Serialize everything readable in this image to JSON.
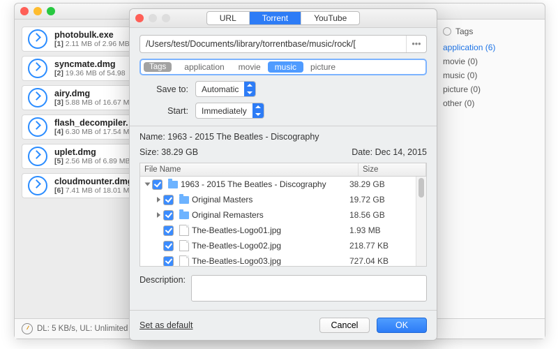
{
  "bg": {
    "downloads": [
      {
        "name": "photobulk.exe",
        "idx": "[1]",
        "done": "2.11 MB",
        "total": "2.96 MB"
      },
      {
        "name": "syncmate.dmg",
        "idx": "[2]",
        "done": "19.36 MB",
        "total": "54.98"
      },
      {
        "name": "airy.dmg",
        "idx": "[3]",
        "done": "5.88 MB",
        "total": "16.67 MB"
      },
      {
        "name": "flash_decompiler.",
        "idx": "[4]",
        "done": "6.30 MB",
        "total": "17.54 M"
      },
      {
        "name": "uplet.dmg",
        "idx": "[5]",
        "done": "2.56 MB",
        "total": "6.89 MB"
      },
      {
        "name": "cloudmounter.dmg",
        "idx": "[6]",
        "done": "7.41 MB",
        "total": "18.01 M"
      }
    ],
    "tags_head": "Tags",
    "tags": [
      {
        "label": "application",
        "count": "(6)",
        "sel": true
      },
      {
        "label": "movie",
        "count": "(0)"
      },
      {
        "label": "music",
        "count": "(0)"
      },
      {
        "label": "picture",
        "count": "(0)"
      },
      {
        "label": "other",
        "count": "(0)"
      }
    ],
    "status": "DL: 5 KB/s, UL: Unlimited"
  },
  "dlg": {
    "tabs": {
      "url": "URL",
      "torrent": "Torrent",
      "youtube": "YouTube"
    },
    "path": "/Users/test/Documents/library/torrentbase/music/rock/[",
    "tag_label": "Tags",
    "tag_chips": [
      {
        "label": "application"
      },
      {
        "label": "movie"
      },
      {
        "label": "music",
        "sel": true
      },
      {
        "label": "picture"
      }
    ],
    "saveto_lbl": "Save to:",
    "saveto_val": "Automatic",
    "start_lbl": "Start:",
    "start_val": "Immediately",
    "name_line": "Name: 1963 - 2015 The Beatles - Discography",
    "size_line": "Size: 38.29 GB",
    "date_line": "Date: Dec 14, 2015",
    "table": {
      "col_name": "File Name",
      "col_size": "Size",
      "rows": [
        {
          "indent": 0,
          "tri": "open",
          "folder": true,
          "name": "1963 - 2015 The Beatles - Discography",
          "size": "38.29 GB"
        },
        {
          "indent": 1,
          "tri": "closed",
          "folder": true,
          "name": "Original Masters",
          "size": "19.72 GB"
        },
        {
          "indent": 1,
          "tri": "closed",
          "folder": true,
          "name": "Original Remasters",
          "size": "18.56 GB"
        },
        {
          "indent": 1,
          "file": true,
          "name": "The-Beatles-Logo01.jpg",
          "size": "1.93 MB"
        },
        {
          "indent": 1,
          "file": true,
          "name": "The-Beatles-Logo02.jpg",
          "size": "218.77 KB"
        },
        {
          "indent": 1,
          "file": true,
          "name": "The-Beatles-Logo03.jpg",
          "size": "727.04 KB"
        }
      ]
    },
    "desc_lbl": "Description:",
    "set_default": "Set as default",
    "cancel": "Cancel",
    "ok": "OK"
  }
}
